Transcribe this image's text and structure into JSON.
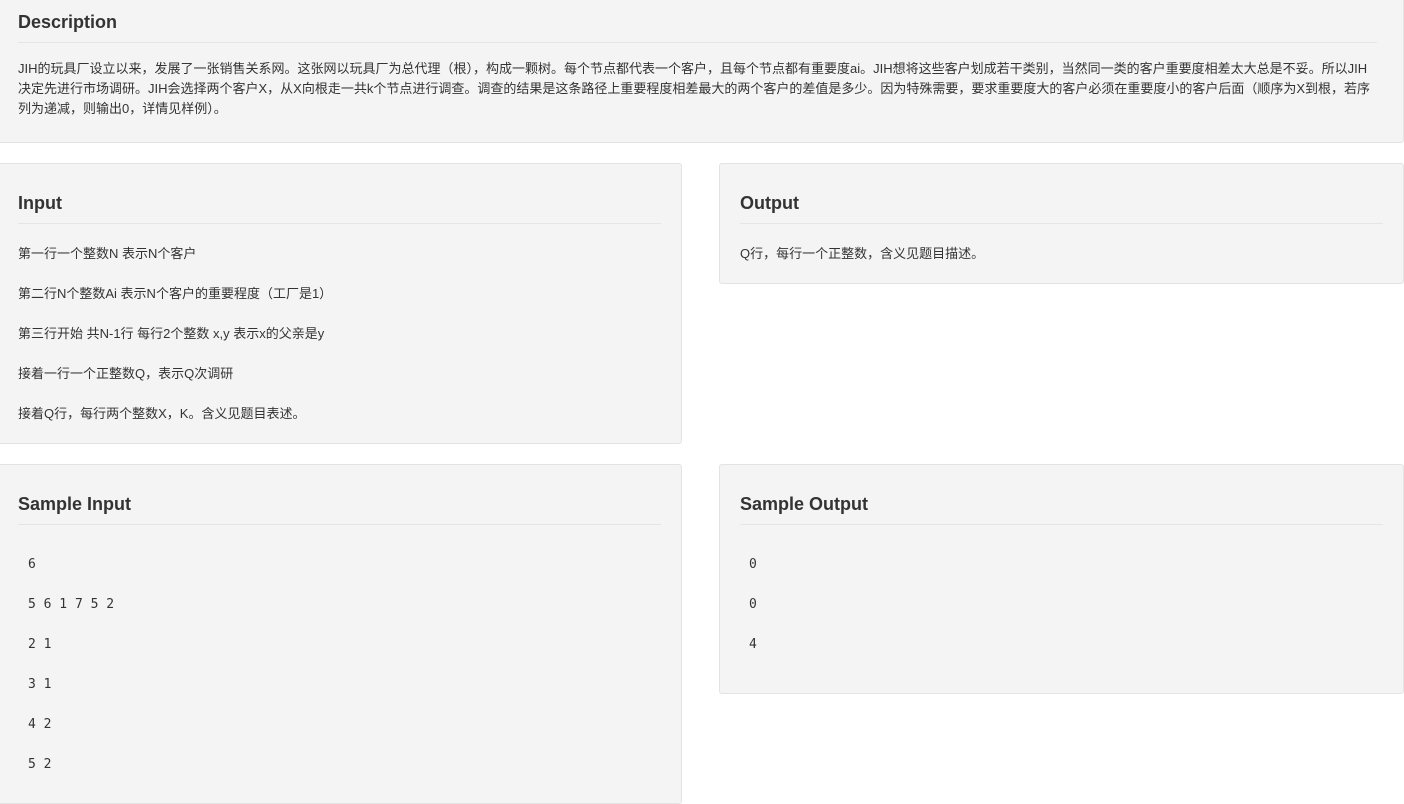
{
  "description": {
    "title": "Description",
    "text": "JIH的玩具厂设立以来，发展了一张销售关系网。这张网以玩具厂为总代理（根），构成一颗树。每个节点都代表一个客户，且每个节点都有重要度ai。JIH想将这些客户划成若干类别，当然同一类的客户重要度相差太大总是不妥。所以JIH决定先进行市场调研。JIH会选择两个客户X，从X向根走一共k个节点进行调查。调查的结果是这条路径上重要程度相差最大的两个客户的差值是多少。因为特殊需要，要求重要度大的客户必须在重要度小的客户后面（顺序为X到根，若序列为递减，则输出0，详情见样例）。"
  },
  "input": {
    "title": "Input",
    "lines": [
      "第一行一个整数N 表示N个客户",
      "第二行N个整数Ai 表示N个客户的重要程度（工厂是1）",
      "第三行开始 共N-1行 每行2个整数 x,y 表示x的父亲是y",
      "接着一行一个正整数Q，表示Q次调研",
      "接着Q行，每行两个整数X，K。含义见题目表述。"
    ]
  },
  "output": {
    "title": "Output",
    "text": "Q行，每行一个正整数，含义见题目描述。"
  },
  "sample_input": {
    "title": "Sample Input",
    "lines": [
      "6",
      "5 6 1 7 5 2",
      "2 1",
      "3 1",
      "4 2",
      "5 2"
    ]
  },
  "sample_output": {
    "title": "Sample Output",
    "lines": [
      "0",
      "0",
      "4"
    ]
  }
}
